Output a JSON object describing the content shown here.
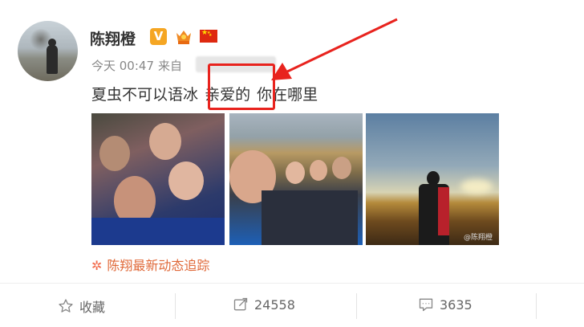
{
  "user": {
    "name": "陈翔橙",
    "verified_badge": "V"
  },
  "meta": {
    "time": "今天 00:47",
    "source_prefix": "来自"
  },
  "post": {
    "text_before": "夏虫不可以语冰",
    "text_highlight": "亲爱的",
    "text_after": "你在哪里"
  },
  "photos": [
    {
      "name": "group-selfie-photo"
    },
    {
      "name": "group-selfie-photo-2",
      "watermark": ""
    },
    {
      "name": "sunset-photo",
      "watermark": "@陈翔橙"
    }
  ],
  "follow": {
    "label": "陈翔最新动态追踪"
  },
  "actions": {
    "favorite": {
      "label": "收藏"
    },
    "repost": {
      "label": "24558"
    },
    "comment": {
      "label": "3635"
    }
  },
  "colors": {
    "annotation_red": "#e8231e",
    "link_orange": "#e06a3a",
    "v_badge": "#f5a623"
  }
}
